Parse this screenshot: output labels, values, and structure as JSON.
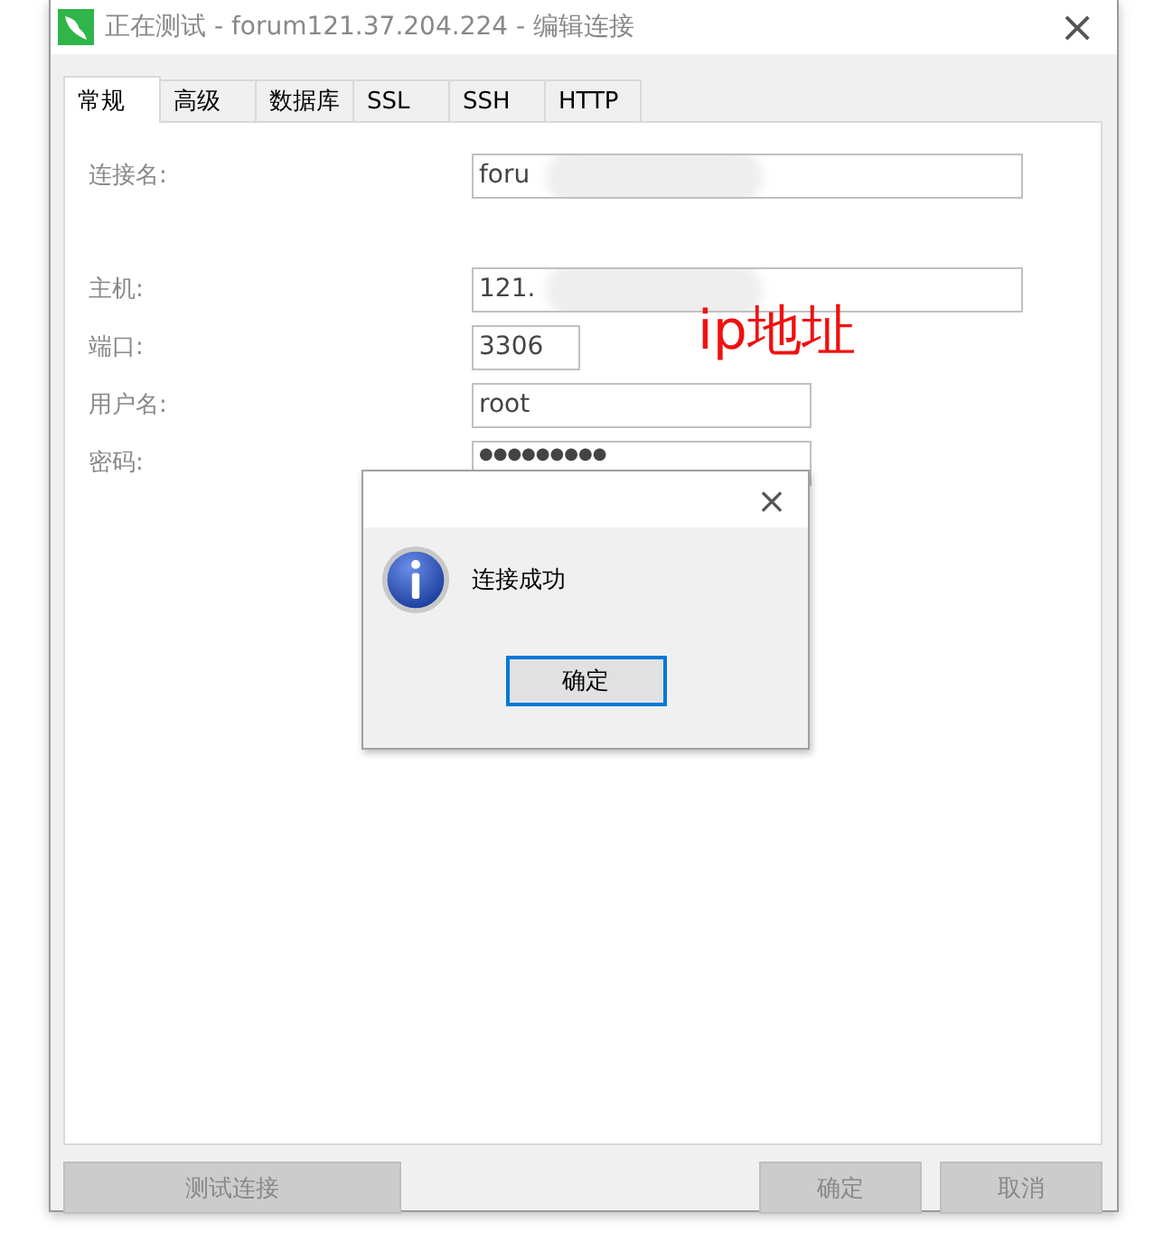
{
  "window": {
    "title": "正在测试 - forum121.37.204.224 - 编辑连接",
    "close": "×"
  },
  "tabs": [
    {
      "label": "常规",
      "selected": true
    },
    {
      "label": "高级",
      "selected": false
    },
    {
      "label": "数据库",
      "selected": false
    },
    {
      "label": "SSL",
      "selected": false
    },
    {
      "label": "SSH",
      "selected": false
    },
    {
      "label": "HTTP",
      "selected": false
    }
  ],
  "fields": [
    {
      "label": "连接名:",
      "value": "foru",
      "blurred": true,
      "gap_before": false
    },
    {
      "label": "主机:",
      "value": "121.",
      "blurred": true,
      "gap_before": true
    },
    {
      "label": "端口:",
      "value": "3306",
      "blurred": false,
      "gap_before": false
    },
    {
      "label": "用户名:",
      "value": "root",
      "blurred": false,
      "gap_before": false
    },
    {
      "label": "密码:",
      "value": "●●●●●●●●●",
      "blurred": false,
      "gap_before": false
    }
  ],
  "annotation": "ip地址",
  "dialog": {
    "close": "×",
    "message": "连接成功",
    "button": "确定"
  },
  "buttons": [
    {
      "label": "测试连接",
      "disabled": true,
      "kind": "left"
    },
    {
      "label": "确定",
      "disabled": true,
      "kind": "right"
    },
    {
      "label": "取消",
      "disabled": true,
      "kind": "right"
    }
  ]
}
